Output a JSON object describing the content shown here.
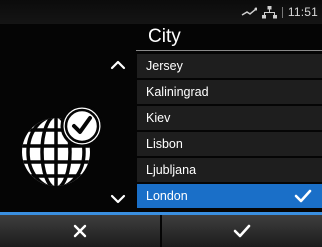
{
  "status_bar": {
    "time": "11:51",
    "icons": [
      "network-icon",
      "lan-icon"
    ]
  },
  "screen": {
    "title": "City"
  },
  "city_list": {
    "items": [
      "Jersey",
      "Kaliningrad",
      "Kiev",
      "Lisbon",
      "Ljubljana",
      "London"
    ],
    "selected": "London"
  },
  "buttons": {
    "cancel_icon": "close-icon",
    "confirm_icon": "check-icon"
  },
  "colors": {
    "accent": "#1a6fc8",
    "background": "#050505",
    "list_item": "#1e1e1e"
  }
}
